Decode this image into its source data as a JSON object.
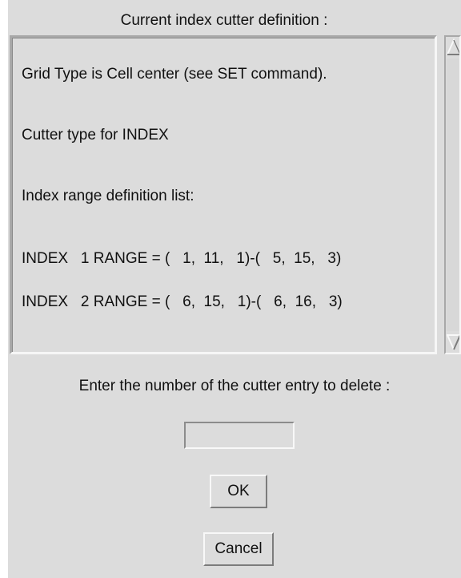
{
  "dialog": {
    "title": "Current index cutter definition :",
    "definition_lines": [
      "Grid Type is Cell center (see SET command).",
      "Cutter type for INDEX",
      "Index range definition list:",
      "INDEX   1 RANGE = (   1,  11,   1)-(   5,  15,   3)",
      "INDEX   2 RANGE = (   6,  15,   1)-(   6,  16,   3)"
    ],
    "prompt": "Enter the number of the cutter entry to delete :",
    "entry_value": "",
    "ok_label": "OK",
    "cancel_label": "Cancel"
  },
  "icons": {
    "scroll_up": "arrow-up-icon",
    "scroll_down": "arrow-down-icon"
  },
  "colors": {
    "background": "#dcdcdc",
    "text": "#111111",
    "shadow": "#a8a8a8",
    "highlight": "#f6f6f6"
  }
}
